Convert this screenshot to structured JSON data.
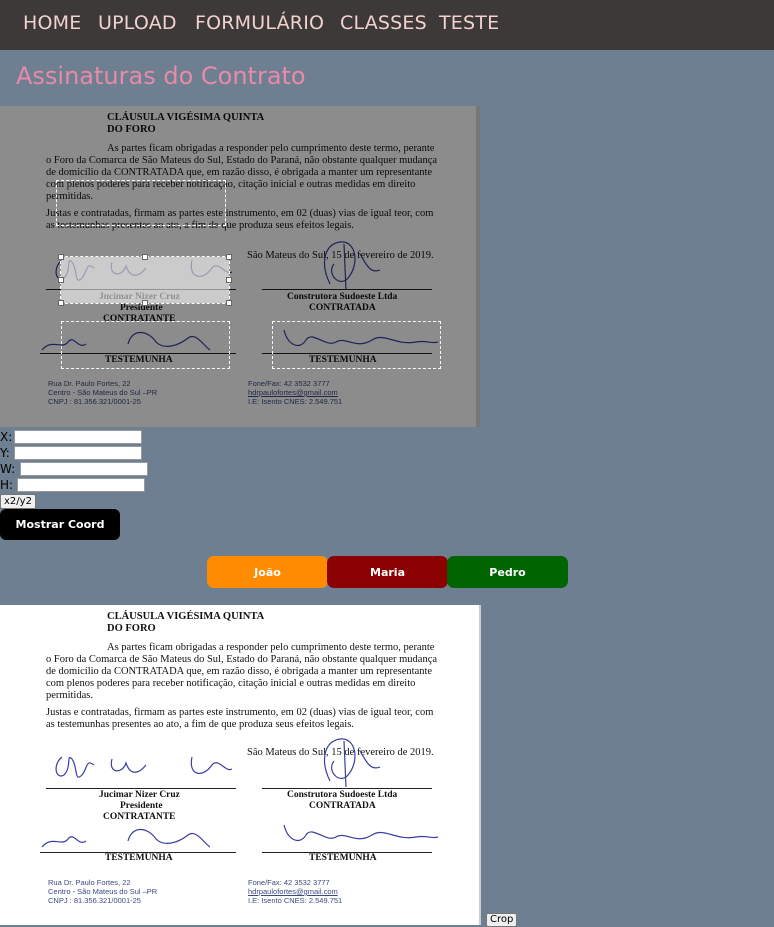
{
  "nav": {
    "items": [
      "HOME",
      "UPLOAD",
      "FORMULÁRIO",
      "CLASSES",
      "TESTE"
    ]
  },
  "page": {
    "title": "Assinaturas do Contrato"
  },
  "document": {
    "heading1": "CLÁUSULA VIGÉSIMA QUINTA",
    "heading2": "DO FORO",
    "para1": [
      "As partes ficam obrigadas a responder pelo cumprimento deste termo, perante",
      "o Foro da Comarca de São Mateus do Sul, Estado do Paraná, não obstante qualquer mudança",
      "de domicílio da CONTRATADA que, em razão disso, é obrigada a manter um representante",
      "com plenos poderes para receber notificação, citação inicial e outras medidas em direito",
      "permitidas."
    ],
    "para2": [
      "Justas e contratadas, firmam as partes este instrumento, em 02 (duas) vias de igual teor, com",
      "as testemunhas presentes ao ato, a fim de que produza seus efeitos legais."
    ],
    "date": "São Mateus do Sul, 15 de fevereiro de 2019.",
    "sig1_name": "Jucimar Nizer Cruz",
    "sig1_role": "Presidente",
    "sig1_party": "CONTRATANTE",
    "sig2_name": "Construtora Sudoeste Ltda",
    "sig2_party": "CONTRATADA",
    "witness_label": "TESTEMUNHA",
    "footer_left": [
      "Rua Dr. Paulo Fortes, 22",
      "Centro - São Mateus do Sul –PR",
      "CNPJ : 81.356.321/0001-25"
    ],
    "footer_right": [
      "Fone/Fax: 42 3532 3777",
      "hdrpaulofortes@gmail.com",
      "I.E: Isento CNES: 2.549.751"
    ]
  },
  "coords": {
    "x_label": "X:",
    "y_label": "Y:",
    "w_label": "W:",
    "h_label": "H:",
    "x_value": "",
    "y_value": "",
    "w_value": "",
    "h_value": "",
    "x2y2_label": "x2/y2",
    "show_label": "Mostrar Coord"
  },
  "people": [
    {
      "label": "João",
      "color": "#ff8c00"
    },
    {
      "label": "Maria",
      "color": "#8b0000"
    },
    {
      "label": "Pedro",
      "color": "#006400"
    }
  ],
  "crop_label": "Crop",
  "colors": {
    "nav_bg": "#3d3939",
    "nav_text": "#f1d2cf",
    "page_bg": "#6f7f92",
    "title": "#e88aa8"
  }
}
